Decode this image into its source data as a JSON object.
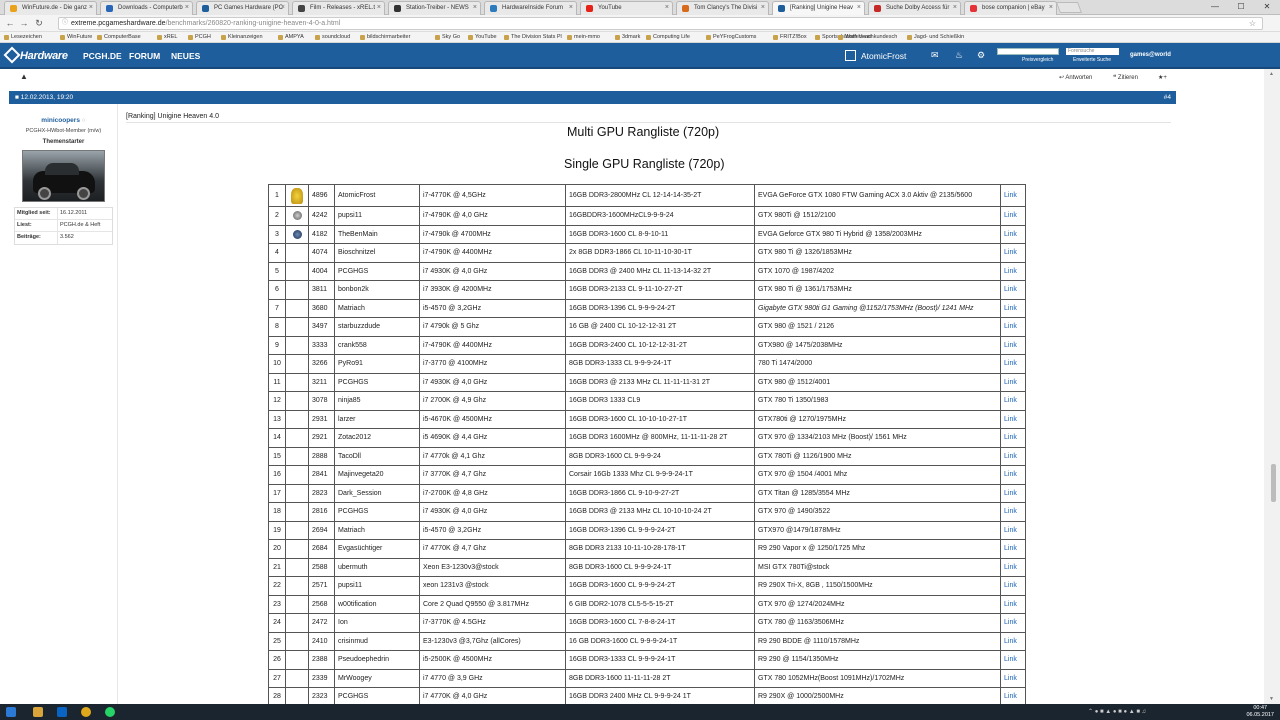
{
  "browser": {
    "tabs": [
      {
        "label": "WinFuture.de - Die ganz",
        "color": "#e9a21a",
        "active": false
      },
      {
        "label": "Downloads - Computerb",
        "color": "#2a66b8",
        "active": false
      },
      {
        "label": "PC Games Hardware (PC",
        "color": "#1f5e9c",
        "active": false
      },
      {
        "label": "Film - Releases - xREL.t",
        "color": "#444",
        "active": false
      },
      {
        "label": "Station-Treiber - NEWS",
        "color": "#333",
        "active": false
      },
      {
        "label": "HardwareInside Forum",
        "color": "#2b7bbd",
        "active": false
      },
      {
        "label": "YouTube",
        "color": "#e62117",
        "active": false
      },
      {
        "label": "Tom Clancy's The Divisi",
        "color": "#d76b1b",
        "active": false
      },
      {
        "label": "[Ranking] Unigine Heav",
        "color": "#1f5e9c",
        "active": true
      },
      {
        "label": "Suche Dolby Access für",
        "color": "#c62828",
        "active": false
      },
      {
        "label": "bose companion | eBay",
        "color": "#e53238",
        "active": false
      }
    ],
    "url_domain": "extreme.pcgameshardware.de",
    "url_path": "/benchmarks/260820-ranking-unigine-heaven-4-0-a.html",
    "bookmarks": [
      "Lesezeichen",
      "WinFuture",
      "ComputerBase",
      "xREL",
      "PCGH",
      "Kleinanzeigen",
      "AMPYA",
      "soundcloud",
      "bildschirmarbeiter",
      "Sky Go",
      "YouTube",
      "The Division Stats Pl",
      "mein-mmo",
      "3dmark",
      "Computing Life",
      "PeYFrogCustoms",
      "FRITZ!Box",
      "Sportschützen Verei",
      "Waffensachkundesch",
      "Jagd- und Schießkin"
    ]
  },
  "site": {
    "logo_text": "Hardware",
    "nav": [
      "PCGH.DE",
      "FORUM",
      "NEUES"
    ],
    "username": "AtomicFrost",
    "search_placeholder": "Forensuche",
    "search_links": [
      "Preisvergleich",
      "Erweiterte Suche"
    ],
    "games_world": "games@world"
  },
  "thread": {
    "actions": [
      "Antworten",
      "Zitieren"
    ],
    "post_date": "12.02.2013, 19:20",
    "post_number": "#4"
  },
  "author": {
    "name": "minicoopers",
    "rank": "PCGHX-HWbot-Member (m/w)",
    "badge": "Themenstarter",
    "info": [
      {
        "key": "Mitglied seit:",
        "value": "16.12.2011"
      },
      {
        "key": "Liest:",
        "value": "PCGH.de & Heft"
      },
      {
        "key": "Beiträge:",
        "value": "3.562"
      }
    ]
  },
  "post": {
    "title": "[Ranking] Unigine Heaven 4.0",
    "heading_multi": "Multi GPU Rangliste (720p)",
    "heading_single": "Single GPU Rangliste (720p)"
  },
  "ranking": [
    {
      "rank": "1",
      "icon": "big",
      "score": "4896",
      "user": "AtomicFrost",
      "cpu": "i7-4770K @ 4,5GHz",
      "ram": "16GB DDR3-2800MHz CL 12-14-14-35-2T",
      "gpu": "EVGA GeForce GTX 1080 FTW Gaming ACX 3.0 Aktiv @ 2135/5600",
      "link": "Link"
    },
    {
      "rank": "2",
      "icon": "small",
      "score": "4242",
      "user": "pupsi11",
      "cpu": "i7-4790K @ 4,0 GHz",
      "ram": "16GBDDR3-1600MHzCL9-9-9-24",
      "gpu": "GTX 980Ti @ 1512/2100",
      "link": "Link"
    },
    {
      "rank": "3",
      "icon": "dark",
      "score": "4182",
      "user": "TheBenMain",
      "cpu": "i7-4790k @ 4700MHz",
      "ram": "16GB DDR3-1600 CL 8-9-10-11",
      "gpu": "EVGA Geforce GTX 980 Ti Hybrid @ 1358/2003MHz",
      "link": "Link"
    },
    {
      "rank": "4",
      "icon": "",
      "score": "4074",
      "user": "Bioschnitzel",
      "cpu": "i7-4790K @ 4400MHz",
      "ram": "2x 8GB DDR3-1866 CL 10-11-10-30-1T",
      "gpu": "GTX 980 Ti @ 1326/1853MHz",
      "link": "Link"
    },
    {
      "rank": "5",
      "icon": "",
      "score": "4004",
      "user": "PCGHGS",
      "cpu": "i7 4930K @ 4,0 GHz",
      "ram": "16GB DDR3 @ 2400 MHz CL 11-13-14-32 2T",
      "gpu": "GTX 1070 @ 1987/4202",
      "link": "Link"
    },
    {
      "rank": "6",
      "icon": "",
      "score": "3811",
      "user": "bonbon2k",
      "cpu": "i7 3930K @ 4200MHz",
      "ram": "16GB DDR3-2133 CL 9-11-10-27-2T",
      "gpu": "GTX 980 Ti @ 1361/1753MHz",
      "link": "Link"
    },
    {
      "rank": "7",
      "icon": "",
      "score": "3680",
      "user": "Matriach",
      "cpu": "i5-4570 @ 3,2GHz",
      "ram": "16GB DDR3-1396 CL 9-9-9-24-2T",
      "gpu": "Gigabyte GTX 980ti G1 Gaming @1152/1753MHz (Boost)/ 1241 MHz",
      "link": "Link"
    },
    {
      "rank": "8",
      "icon": "",
      "score": "3497",
      "user": "starbuzzdude",
      "cpu": "i7 4790k @ 5 Ghz",
      "ram": "16 GB @ 2400 CL 10-12-12-31 2T",
      "gpu": "GTX 980 @ 1521 / 2126",
      "link": "Link"
    },
    {
      "rank": "9",
      "icon": "",
      "score": "3333",
      "user": "crank558",
      "cpu": "i7-4790K @ 4400MHz",
      "ram": "16GB DDR3-2400 CL 10-12-12-31-2T",
      "gpu": "GTX980 @ 1475/2038MHz",
      "link": "Link"
    },
    {
      "rank": "10",
      "icon": "",
      "score": "3266",
      "user": "PyRo91",
      "cpu": "i7-3770 @ 4100MHz",
      "ram": "8GB DDR3-1333 CL 9-9-9-24-1T",
      "gpu": "780 Ti 1474/2000",
      "link": "Link"
    },
    {
      "rank": "11",
      "icon": "",
      "score": "3211",
      "user": "PCGHGS",
      "cpu": "i7 4930K @ 4,0 GHz",
      "ram": "16GB DDR3 @ 2133 MHz CL 11-11-11-31 2T",
      "gpu": "GTX 980 @ 1512/4001",
      "link": "Link"
    },
    {
      "rank": "12",
      "icon": "",
      "score": "3078",
      "user": "ninja85",
      "cpu": "i7 2700K @ 4,9 Ghz",
      "ram": "16GB DDR3 1333 CL9",
      "gpu": "GTX 780 Ti 1350/1983",
      "link": "Link"
    },
    {
      "rank": "13",
      "icon": "",
      "score": "2931",
      "user": "larzer",
      "cpu": "i5-4670K @ 4500MHz",
      "ram": "16GB DDR3-1600 CL 10-10-10-27-1T",
      "gpu": "GTX780ti @ 1270/1975MHz",
      "link": "Link"
    },
    {
      "rank": "14",
      "icon": "",
      "score": "2921",
      "user": "Zotac2012",
      "cpu": "i5 4690K @ 4,4 GHz",
      "ram": "16GB DDR3 1600MHz @ 800MHz, 11-11-11-28 2T",
      "gpu": "GTX 970 @ 1334/2103 MHz (Boost)/ 1561 MHz",
      "link": "Link"
    },
    {
      "rank": "15",
      "icon": "",
      "score": "2888",
      "user": "TacoDll",
      "cpu": "i7 4770k @ 4,1 Ghz",
      "ram": "8GB DDR3-1600 CL 9-9-9-24",
      "gpu": "GTX 780Ti @ 1126/1900 MHz",
      "link": "Link"
    },
    {
      "rank": "16",
      "icon": "",
      "score": "2841",
      "user": "Majinvegeta20",
      "cpu": "i7 3770K @ 4,7 Ghz",
      "ram": "Corsair 16Gb 1333 Mhz CL 9-9-9-24-1T",
      "gpu": "GTX 970 @ 1504 /4001 Mhz",
      "link": "Link"
    },
    {
      "rank": "17",
      "icon": "",
      "score": "2823",
      "user": "Dark_Session",
      "cpu": "i7-2700K @ 4,8 GHz",
      "ram": "16GB DDR3-1866 CL 9-10-9-27-2T",
      "gpu": "GTX Titan @ 1285/3554 MHz",
      "link": "Link"
    },
    {
      "rank": "18",
      "icon": "",
      "score": "2816",
      "user": "PCGHGS",
      "cpu": "i7 4930K @ 4,0 GHz",
      "ram": "16GB DDR3 @ 2133 MHz CL 10-10-10-24 2T",
      "gpu": "GTX 970 @ 1490/3522",
      "link": "Link"
    },
    {
      "rank": "19",
      "icon": "",
      "score": "2694",
      "user": "Matriach",
      "cpu": "i5-4570 @ 3,2GHz",
      "ram": "16GB DDR3-1396 CL 9-9-9-24-2T",
      "gpu": "GTX970 @1479/1878MHz",
      "link": "Link"
    },
    {
      "rank": "20",
      "icon": "",
      "score": "2684",
      "user": "Evgasüchtiger",
      "cpu": "i7 4770K @ 4,7 Ghz",
      "ram": "8GB DDR3 2133 10-11-10-28-178-1T",
      "gpu": "R9 290 Vapor x @ 1250/1725 Mhz",
      "link": "Link"
    },
    {
      "rank": "21",
      "icon": "",
      "score": "2588",
      "user": "ubermuth",
      "cpu": "Xeon E3-1230v3@stock",
      "ram": "8GB DDR3-1600 CL 9-9-9-24-1T",
      "gpu": "MSI GTX 780Ti@stock",
      "link": "Link"
    },
    {
      "rank": "22",
      "icon": "",
      "score": "2571",
      "user": "pupsi11",
      "cpu": "xeon 1231v3 @stock",
      "ram": "16GB DDR3-1600 CL 9-9-9-24-2T",
      "gpu": "R9 290X Tri-X, 8GB , 1150/1500MHz",
      "link": "Link"
    },
    {
      "rank": "23",
      "icon": "",
      "score": "2568",
      "user": "w00tification",
      "cpu": "Core 2 Quad Q9550 @ 3.817MHz",
      "ram": "6 GIB DDR2-1078 CL5-5-5-15-2T",
      "gpu": "GTX 970 @ 1274/2024MHz",
      "link": "Link"
    },
    {
      "rank": "24",
      "icon": "",
      "score": "2472",
      "user": "Ion",
      "cpu": "i7-3770K @ 4.5GHz",
      "ram": "16GB DDR3-1600 CL 7-8-8-24-1T",
      "gpu": "GTX 780 @ 1163/3506MHz",
      "link": "Link"
    },
    {
      "rank": "25",
      "icon": "",
      "score": "2410",
      "user": "crisinmud",
      "cpu": "E3-1230v3 @3,7Ghz (allCores)",
      "ram": "16 GB DDR3-1600 CL 9-9-9-24-1T",
      "gpu": "R9 290 BDDE @ 1110/1578MHz",
      "link": "Link"
    },
    {
      "rank": "26",
      "icon": "",
      "score": "2388",
      "user": "Pseudoephedrin",
      "cpu": "i5-2500K @ 4500MHz",
      "ram": "16GB DDR3-1333 CL 9-9-9-24-1T",
      "gpu": "R9 290 @ 1154/1350MHz",
      "link": "Link"
    },
    {
      "rank": "27",
      "icon": "",
      "score": "2339",
      "user": "MrWoogey",
      "cpu": "i7 4770 @ 3,9 GHz",
      "ram": "8GB DDR3-1600 11-11-11-28 2T",
      "gpu": "GTX 780 1052MHz(Boost 1091MHz)/1702MHz",
      "link": "Link"
    },
    {
      "rank": "28",
      "icon": "",
      "score": "2323",
      "user": "PCGHGS",
      "cpu": "i7 4770K @ 4,0 GHz",
      "ram": "16GB DDR3 2400 MHz CL 9-9-9-24 1T",
      "gpu": "R9 290X @ 1000/2500MHz",
      "link": "Link"
    }
  ],
  "taskbar": {
    "time": "00:47",
    "date": "06.05.2017"
  },
  "colors": {
    "accent": "#1f5e9c",
    "link": "#1a63b8"
  }
}
